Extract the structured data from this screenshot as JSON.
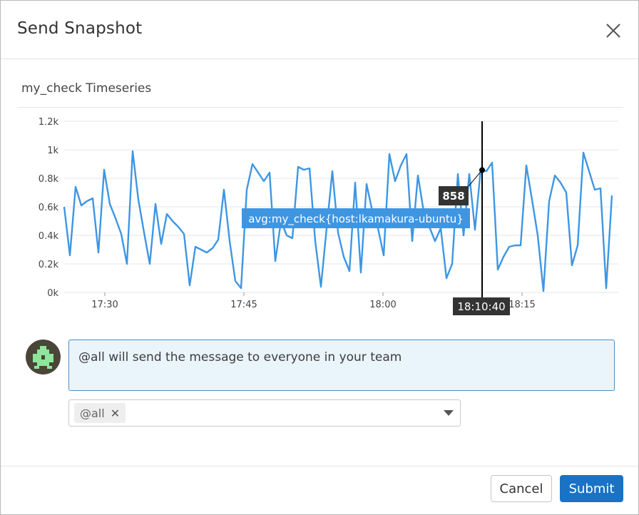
{
  "dialog": {
    "title": "Send Snapshot",
    "close_icon": "close-icon"
  },
  "graph": {
    "title": "my_check Timeseries"
  },
  "chart_data": {
    "type": "line",
    "title": "my_check Timeseries",
    "xlabel": "",
    "ylabel": "",
    "ylim": [
      0,
      1200
    ],
    "yticks": [
      "0k",
      "0.2k",
      "0.4k",
      "0.6k",
      "0.8k",
      "1k",
      "1.2k"
    ],
    "xticks": [
      "17:30",
      "17:45",
      "18:00",
      "18:15"
    ],
    "grid": true,
    "series": [
      {
        "name": "avg:my_check{host:lkamakura-ubuntu}",
        "color": "#3e96e3",
        "values": [
          600,
          260,
          740,
          610,
          640,
          660,
          280,
          860,
          620,
          520,
          410,
          200,
          990,
          650,
          420,
          200,
          620,
          340,
          550,
          500,
          460,
          410,
          50,
          320,
          300,
          280,
          310,
          370,
          720,
          360,
          80,
          30,
          720,
          900,
          840,
          780,
          840,
          220,
          500,
          400,
          380,
          880,
          860,
          870,
          360,
          40,
          450,
          850,
          420,
          250,
          150,
          770,
          140,
          760,
          570,
          450,
          260,
          970,
          780,
          890,
          970,
          360,
          820,
          570,
          460,
          360,
          450,
          100,
          200,
          830,
          400,
          830,
          440,
          860,
          850,
          910,
          160,
          250,
          320,
          330,
          330,
          890,
          650,
          400,
          10,
          640,
          820,
          770,
          700,
          190,
          330,
          980,
          850,
          720,
          730,
          30,
          680
        ]
      }
    ],
    "tooltip": {
      "series_label": "avg:my_check{host:lkamakura-ubuntu}",
      "value_label": "858",
      "value": 858,
      "time_label": "18:10:40"
    }
  },
  "message": {
    "text": "@all will send the message to everyone in your team"
  },
  "recipients": {
    "tokens": [
      {
        "label": "@all",
        "remove_symbol": "✕"
      }
    ]
  },
  "footer": {
    "cancel_label": "Cancel",
    "submit_label": "Submit"
  },
  "colors": {
    "accent": "#1a72c5",
    "series": "#3e96e3",
    "tooltip_dark": "#333333",
    "message_bg": "#eaf4fb"
  }
}
